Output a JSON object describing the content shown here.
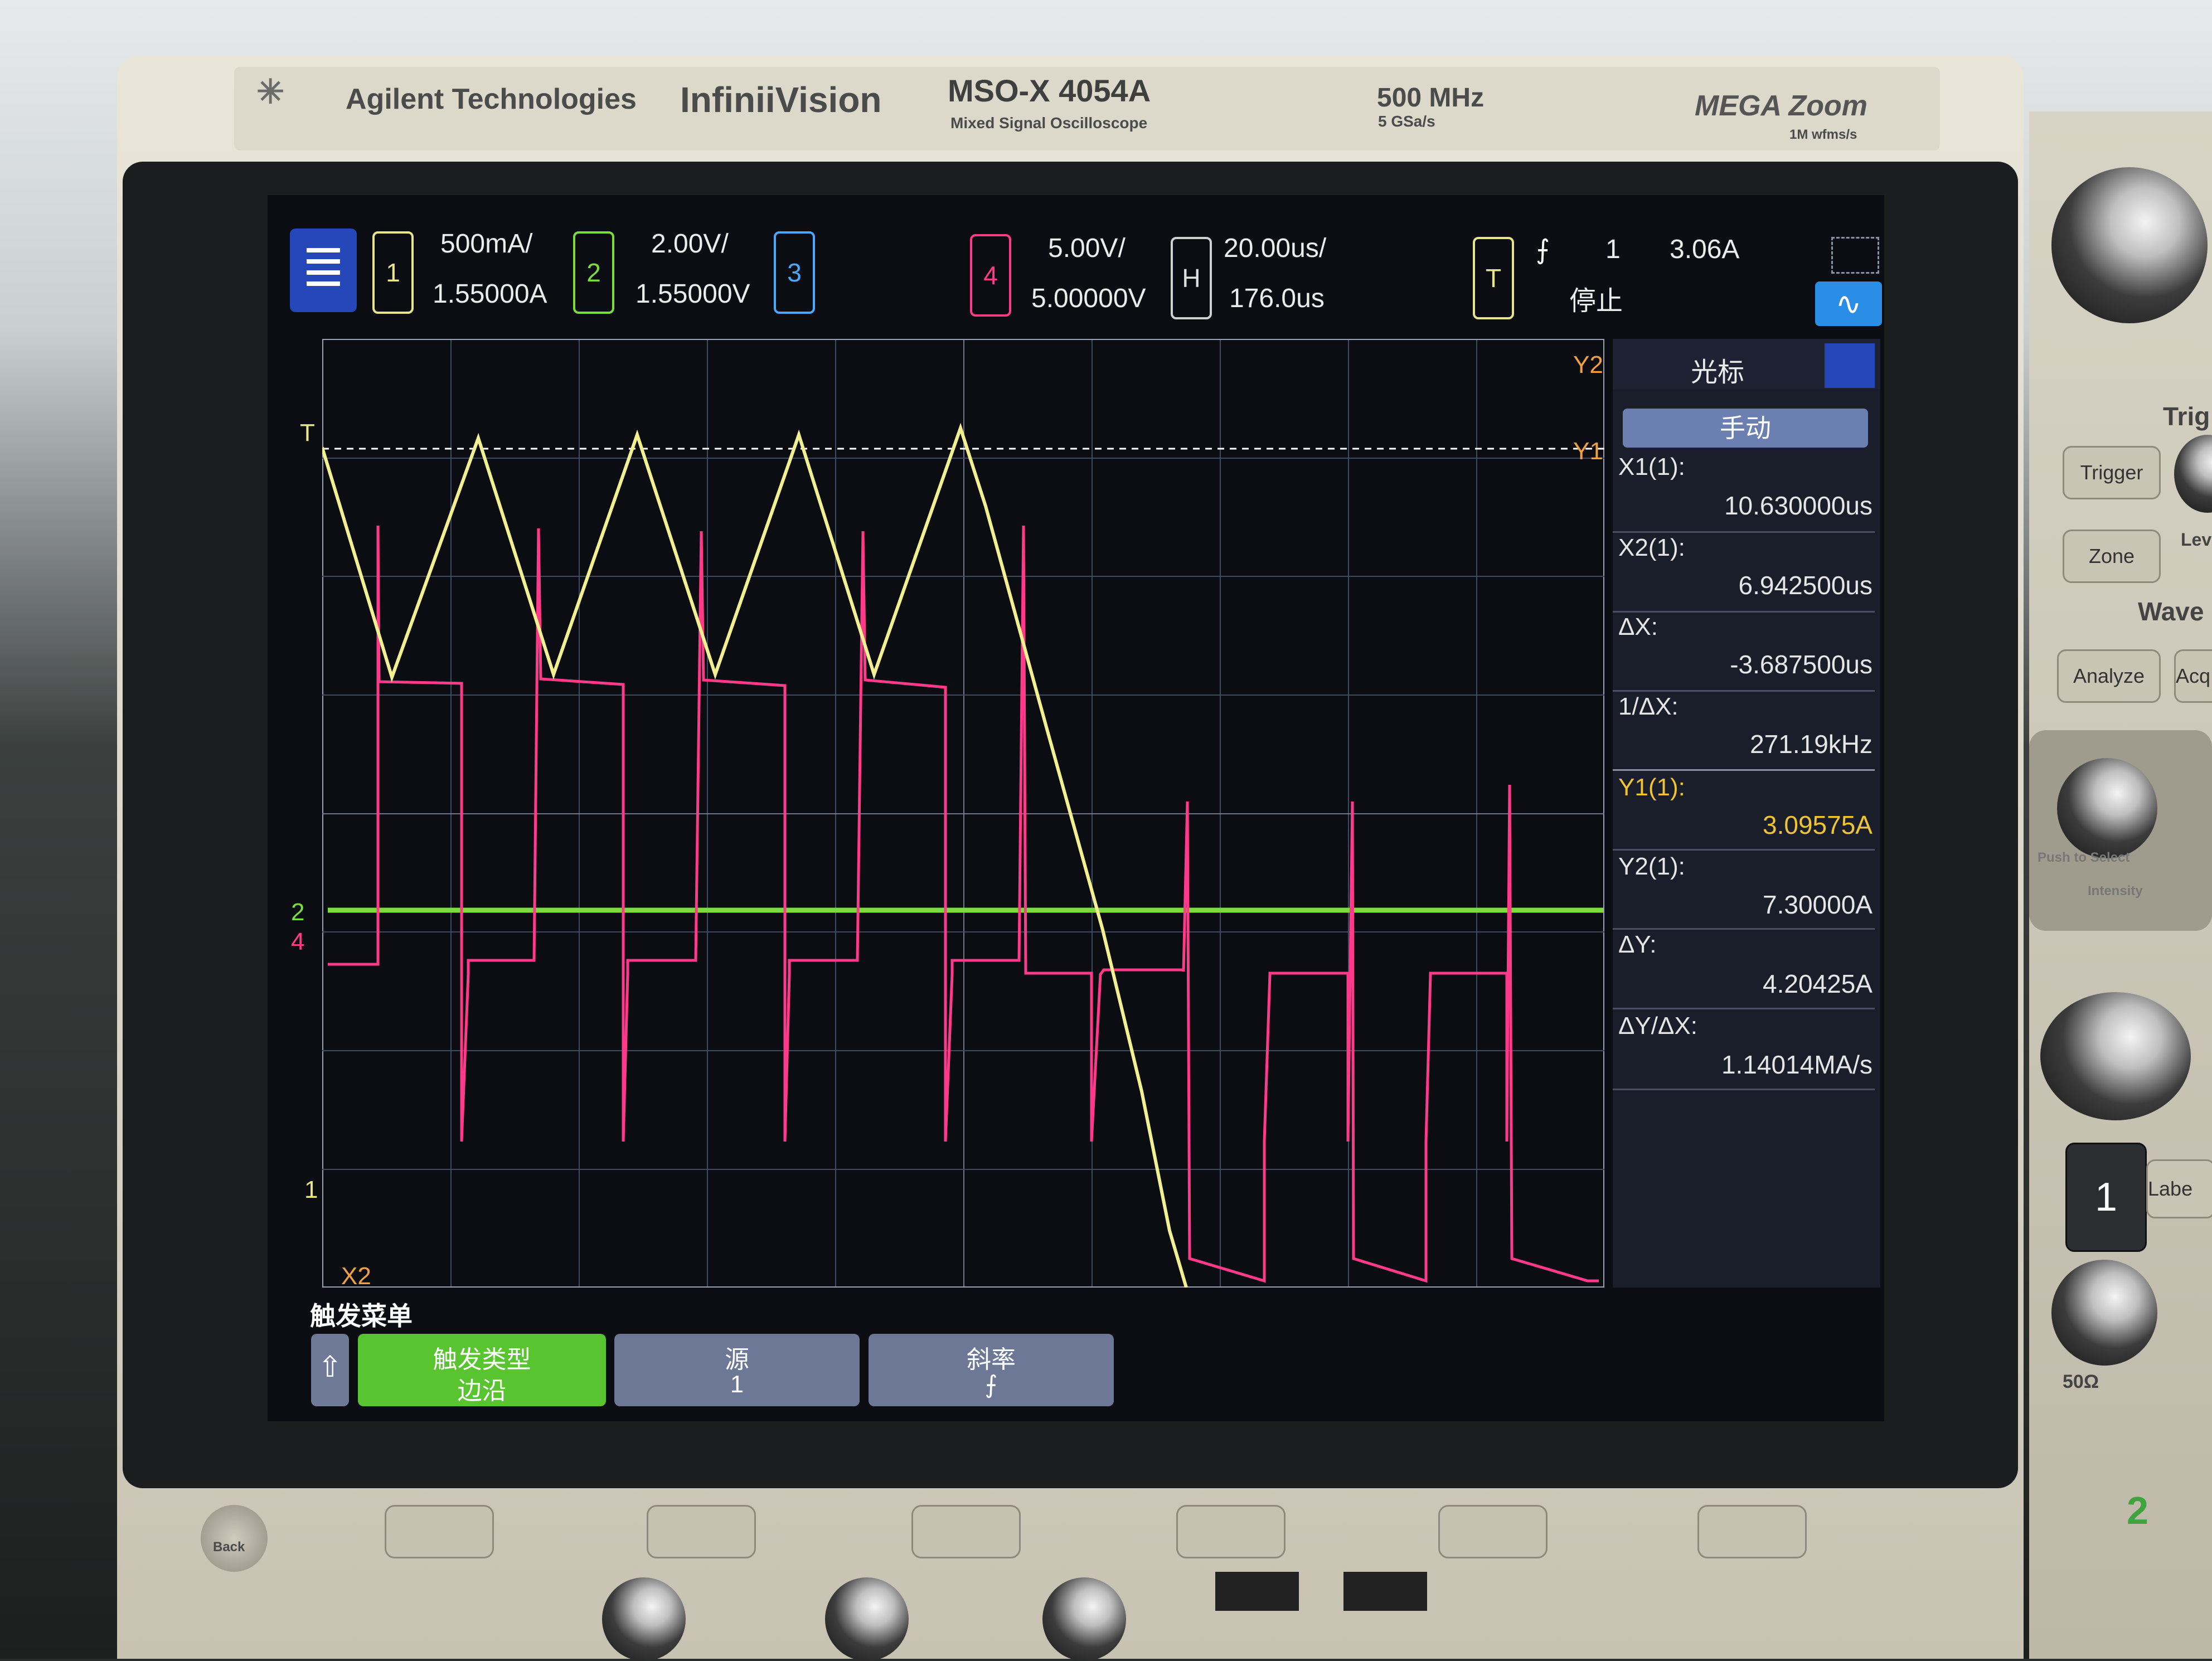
{
  "instrument": {
    "brand": "Agilent Technologies",
    "series": "InfiniiVision",
    "model": "MSO-X 4054A",
    "model_sub": "Mixed Signal Oscilloscope",
    "bandwidth": "500 MHz",
    "sample_rate": "5 GSa/s",
    "megazoom": "MEGA Zoom",
    "megazoom_sub": "1M wfms/s",
    "panel_labels": {
      "trigger_btn": "Trigger",
      "zone_btn": "Zone",
      "analyze_btn": "Analyze",
      "acq_btn": "Acq",
      "trig_title": "Trig",
      "wave_title": "Wave",
      "level_label": "Lev",
      "push_to_select": "Push to Select",
      "intensity": "Intensity",
      "ch1_key": "1",
      "label_key": "Labe",
      "impedance": "50Ω",
      "ch2_key": "2",
      "back_label": "Back"
    }
  },
  "topbar": {
    "ch1": {
      "num": "1",
      "scale": "500mA/",
      "offset": "1.55000A",
      "color": "#e8e68a"
    },
    "ch2": {
      "num": "2",
      "scale": "2.00V/",
      "offset": "1.55000V",
      "color": "#7cdc3a"
    },
    "ch3": {
      "num": "3",
      "color": "#4aa8ff"
    },
    "ch4": {
      "num": "4",
      "scale": "5.00V/",
      "offset": "5.00000V",
      "color": "#ff3a8a"
    },
    "horizontal": {
      "label": "H",
      "scale": "20.00us/",
      "delay": "176.0us"
    },
    "trigger": {
      "label": "T",
      "slope_icon": "rising-edge-icon",
      "source": "1",
      "level": "3.06A",
      "status": "停止"
    }
  },
  "markers": {
    "y2": "Y2",
    "y1": "Y1",
    "x2": "X2",
    "trigger_level": "T",
    "ch2_ground": "2",
    "ch4_ground": "4",
    "ch1_ground": "1"
  },
  "cursors_panel": {
    "title": "光标",
    "mode": "手动",
    "rows": [
      {
        "label": "X1(1):",
        "value": "10.630000us",
        "highlight": false
      },
      {
        "label": "X2(1):",
        "value": "6.942500us",
        "highlight": false
      },
      {
        "label": "ΔX:",
        "value": "-3.687500us",
        "highlight": false
      },
      {
        "label": "1/ΔX:",
        "value": "271.19kHz",
        "highlight": false
      },
      {
        "label": "Y1(1):",
        "value": "3.09575A",
        "highlight": true
      },
      {
        "label": "Y2(1):",
        "value": "7.30000A",
        "highlight": false
      },
      {
        "label": "ΔY:",
        "value": "4.20425A",
        "highlight": false
      },
      {
        "label": "ΔY/ΔX:",
        "value": "1.14014MA/s",
        "highlight": false
      }
    ],
    "highlight_color": "#f0c430"
  },
  "softkeys": {
    "menu_title": "触发菜单",
    "up_icon": "up-arrow-icon",
    "keys": [
      {
        "line1": "触发类型",
        "line2": "边沿",
        "active": true
      },
      {
        "line1": "源",
        "line2": "1",
        "active": false
      },
      {
        "line1": "斜率",
        "line2": "⨍",
        "active": false
      }
    ]
  }
}
